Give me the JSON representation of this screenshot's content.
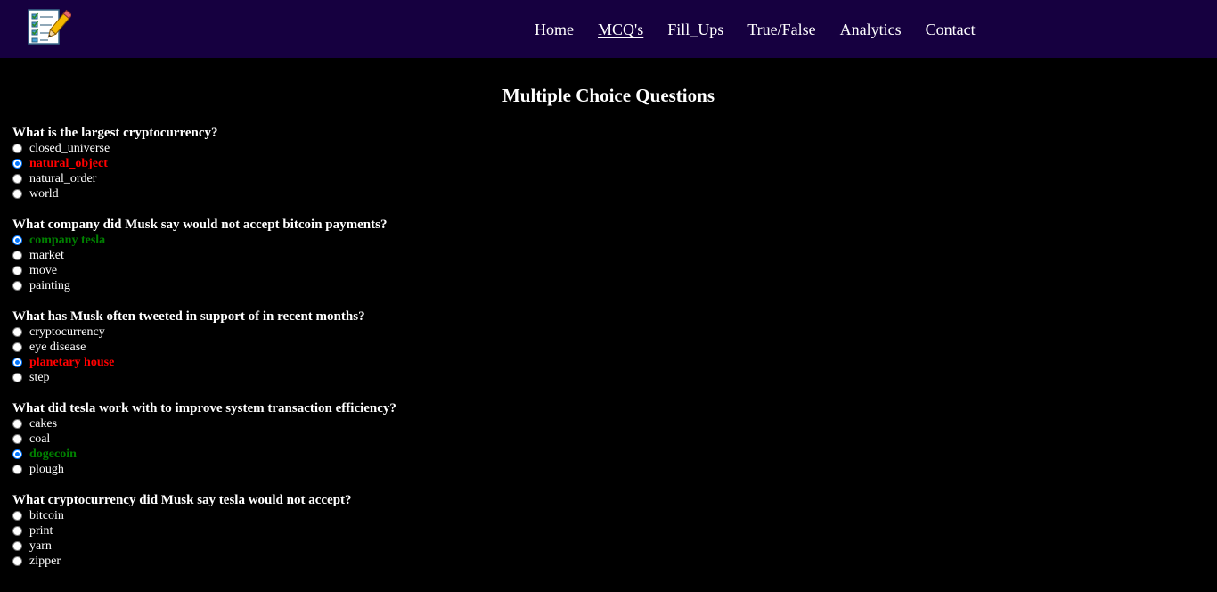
{
  "nav": {
    "items": [
      {
        "label": "Home",
        "active": false
      },
      {
        "label": "MCQ's",
        "active": true
      },
      {
        "label": "Fill_Ups",
        "active": false
      },
      {
        "label": "True/False",
        "active": false
      },
      {
        "label": "Analytics",
        "active": false
      },
      {
        "label": "Contact",
        "active": false
      }
    ]
  },
  "page": {
    "title": "Multiple Choice Questions"
  },
  "colors": {
    "navbar_bg": "#160040",
    "background": "#000000",
    "wrong": "#ff0000",
    "correct": "#008000",
    "radio_accent": "#0075ff"
  },
  "logo": {
    "icon": "quiz-checklist-pencil-icon"
  },
  "questions": [
    {
      "text": "What is the largest cryptocurrency?",
      "options": [
        {
          "label": "closed_universe",
          "selected": false,
          "state": ""
        },
        {
          "label": "natural_object",
          "selected": true,
          "state": "wrong"
        },
        {
          "label": "natural_order",
          "selected": false,
          "state": ""
        },
        {
          "label": "world",
          "selected": false,
          "state": ""
        }
      ]
    },
    {
      "text": "What company did Musk say would not accept bitcoin payments?",
      "options": [
        {
          "label": "company tesla",
          "selected": true,
          "state": "correct"
        },
        {
          "label": "market",
          "selected": false,
          "state": ""
        },
        {
          "label": "move",
          "selected": false,
          "state": ""
        },
        {
          "label": "painting",
          "selected": false,
          "state": ""
        }
      ]
    },
    {
      "text": "What has Musk often tweeted in support of in recent months?",
      "options": [
        {
          "label": "cryptocurrency",
          "selected": false,
          "state": ""
        },
        {
          "label": "eye disease",
          "selected": false,
          "state": ""
        },
        {
          "label": "planetary house",
          "selected": true,
          "state": "wrong"
        },
        {
          "label": "step",
          "selected": false,
          "state": ""
        }
      ]
    },
    {
      "text": "What did tesla work with to improve system transaction efficiency?",
      "options": [
        {
          "label": "cakes",
          "selected": false,
          "state": ""
        },
        {
          "label": "coal",
          "selected": false,
          "state": ""
        },
        {
          "label": "dogecoin",
          "selected": true,
          "state": "correct"
        },
        {
          "label": "plough",
          "selected": false,
          "state": ""
        }
      ]
    },
    {
      "text": "What cryptocurrency did Musk say tesla would not accept?",
      "options": [
        {
          "label": "bitcoin",
          "selected": false,
          "state": ""
        },
        {
          "label": "print",
          "selected": false,
          "state": ""
        },
        {
          "label": "yarn",
          "selected": false,
          "state": ""
        },
        {
          "label": "zipper",
          "selected": false,
          "state": ""
        }
      ]
    }
  ]
}
